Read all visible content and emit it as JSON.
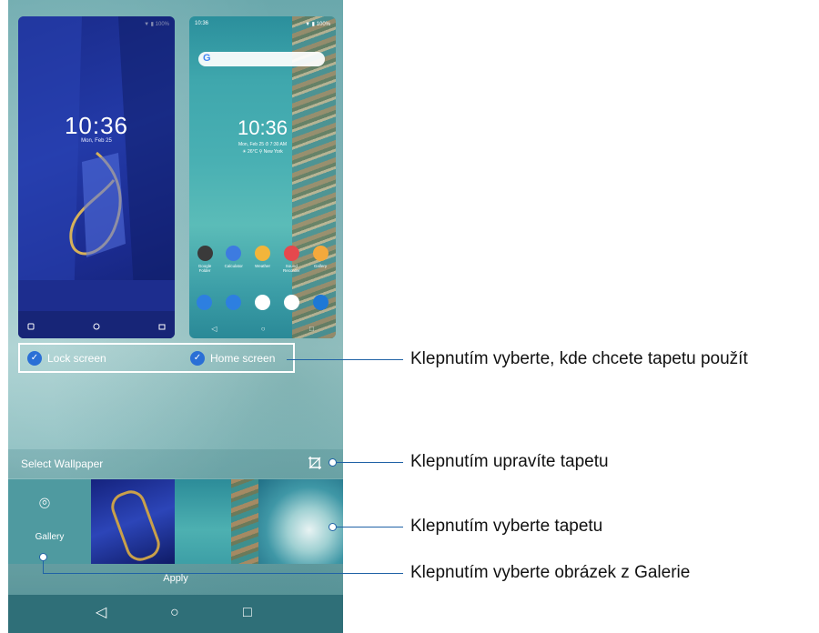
{
  "lock_preview": {
    "status": "▼ ▮ 100%",
    "time": "10:36",
    "date": "Mon, Feb 25"
  },
  "home_preview": {
    "status_left": "10:36",
    "status_right": "▼ ▮ 100%",
    "search_logo": "G",
    "time": "10:36",
    "date": "Mon, Feb 25  ⏱ 7:30 AM",
    "weather": "☀ 26°C  ⚲ New York",
    "apps": [
      {
        "label": "Google Folder",
        "color": "#3a3a3a"
      },
      {
        "label": "Calculator",
        "color": "#3d7be0"
      },
      {
        "label": "Weather",
        "color": "#f2b53b"
      },
      {
        "label": "Sound Recorder",
        "color": "#e5484d"
      },
      {
        "label": "Gallery",
        "color": "#f4a93c"
      }
    ],
    "dock_colors": [
      "#2d7fe0",
      "#2d7fe0",
      "#ffffff",
      "#ffffff",
      "#1e78d6"
    ],
    "nav": [
      "◁",
      "○",
      "□"
    ]
  },
  "checks": {
    "lock": "Lock screen",
    "home": "Home screen",
    "check_glyph": "✓"
  },
  "select": {
    "label": "Select Wallpaper"
  },
  "gallery": {
    "icon": "⌾",
    "label": "Gallery"
  },
  "apply": {
    "label": "Apply"
  },
  "navbar": {
    "back": "◁",
    "home": "○",
    "recents": "□"
  },
  "callouts": [
    "Klepnutím vyberte, kde chcete tapetu použít",
    "Klepnutím upravíte tapetu",
    "Klepnutím vyberte tapetu",
    "Klepnutím vyberte obrázek z Galerie"
  ],
  "colors": {
    "accent_blue": "#1f62a6",
    "checkbox_blue": "#2a6fd6"
  }
}
